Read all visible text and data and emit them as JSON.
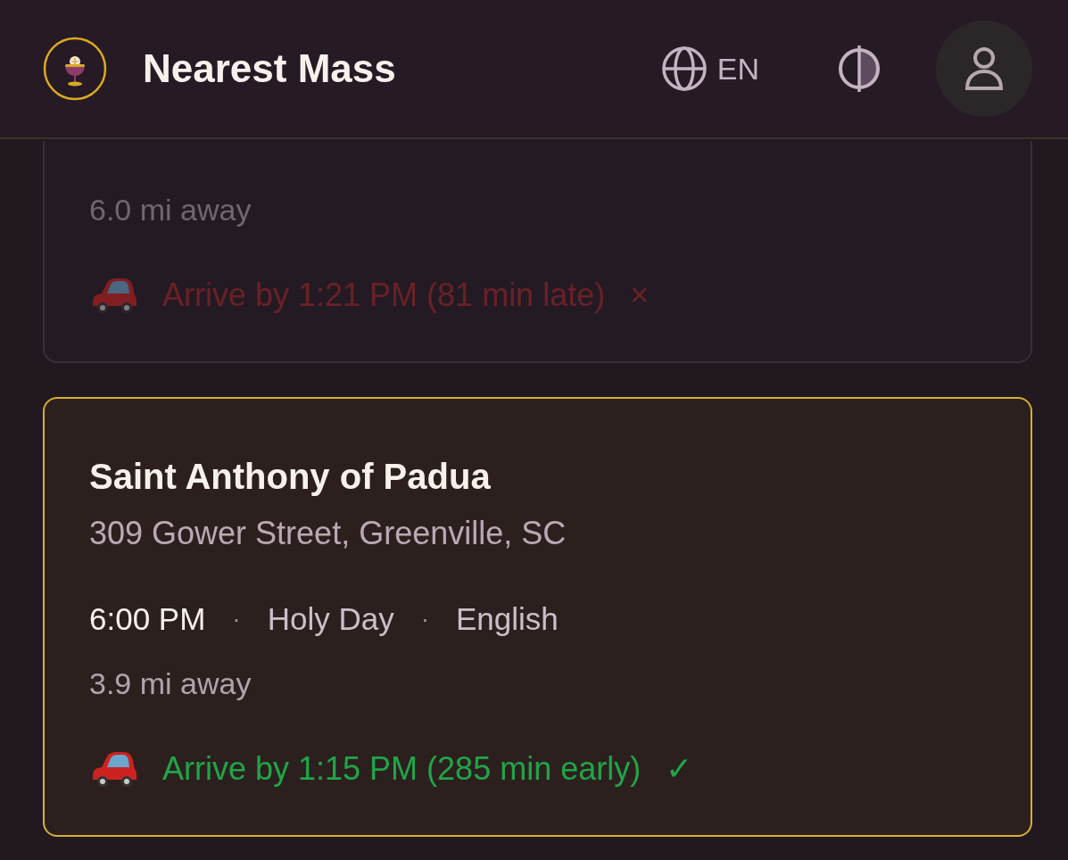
{
  "header": {
    "title": "Nearest Mass",
    "language": "EN"
  },
  "cards": [
    {
      "selected": false,
      "distance": "6.0 mi away",
      "arrival": {
        "late": true,
        "text": "Arrive by 1:21 PM (81 min late)",
        "mark": "×"
      }
    },
    {
      "selected": true,
      "name": "Saint Anthony of Padua",
      "address": "309 Gower Street, Greenville, SC",
      "details": [
        {
          "kind": "time",
          "text": "6:00 PM"
        },
        {
          "kind": "dot",
          "text": "·"
        },
        {
          "kind": "info",
          "text": "Holy Day"
        },
        {
          "kind": "dot",
          "text": "·"
        },
        {
          "kind": "info",
          "text": "English"
        }
      ],
      "distance": "3.9 mi away",
      "arrival": {
        "late": false,
        "text": "Arrive by 1:15 PM (285 min early)",
        "mark": "✓"
      }
    }
  ]
}
